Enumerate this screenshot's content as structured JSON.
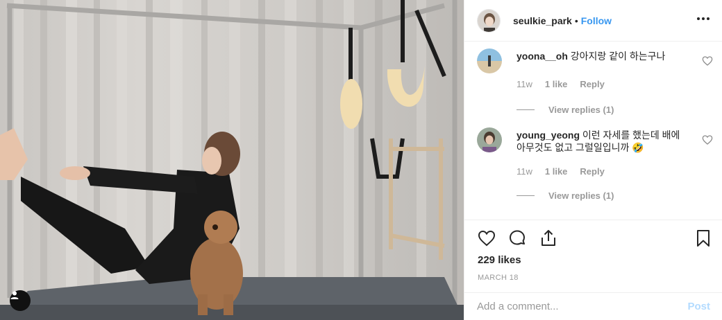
{
  "post": {
    "author": "seulkie_park",
    "separator": "•",
    "follow_label": "Follow",
    "likes": "229 likes",
    "date": "MARCH 18"
  },
  "comments": [
    {
      "user": "yoona__oh",
      "text": "강아지랑 같이 하는구나",
      "age": "11w",
      "likes": "1 like",
      "reply_label": "Reply",
      "view_replies": "View replies (1)"
    },
    {
      "user": "young_yeong",
      "text": "이런 자세를 했는데 배에 아무것도 없고 그럴일입니까 🤣",
      "age": "11w",
      "likes": "1 like",
      "reply_label": "Reply",
      "view_replies": "View replies (1)"
    }
  ],
  "comment_box": {
    "placeholder": "Add a comment...",
    "post_label": "Post"
  },
  "colors": {
    "link": "#3897f0",
    "muted": "#999999",
    "post_disabled": "#b3dbff"
  },
  "icons": [
    "heart-icon",
    "comment-icon",
    "share-icon",
    "bookmark-icon",
    "more-options-icon",
    "user-tag-icon"
  ]
}
